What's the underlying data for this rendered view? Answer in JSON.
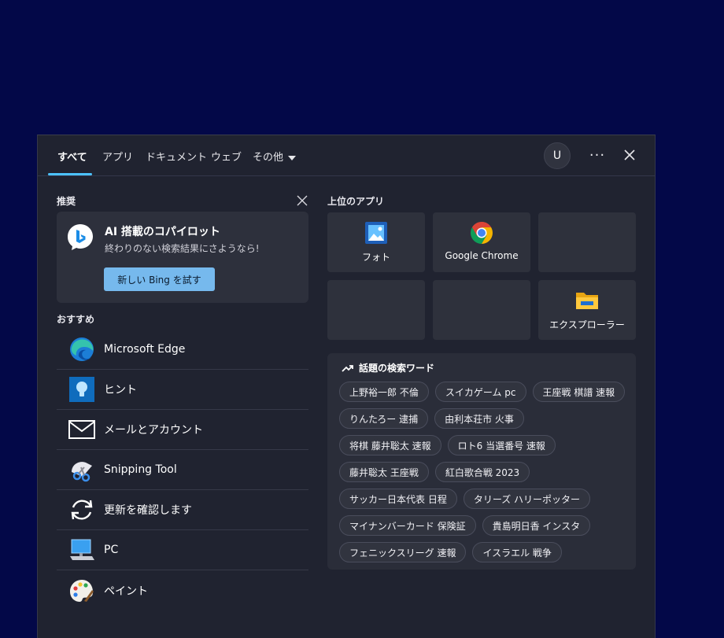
{
  "tabs": [
    {
      "label": "すべて"
    },
    {
      "label": "アプリ"
    },
    {
      "label": "ドキュメント"
    },
    {
      "label": "ウェブ"
    },
    {
      "label": "その他"
    }
  ],
  "account": {
    "initial": "U"
  },
  "toolbar": {
    "more_label": "···"
  },
  "recommended": {
    "label": "推奨",
    "copilot": {
      "title": "AI 搭載のコパイロット",
      "subtitle": "終わりのない検索結果にさようなら!",
      "button_label": "新しい Bing を試す"
    }
  },
  "suggested": {
    "label": "おすすめ",
    "apps": [
      {
        "name": "Microsoft Edge",
        "icon": "edge-icon"
      },
      {
        "name": "ヒント",
        "icon": "tips-icon"
      },
      {
        "name": "メールとアカウント",
        "icon": "mail-icon"
      },
      {
        "name": "Snipping Tool",
        "icon": "snipping-tool-icon"
      },
      {
        "name": "更新を確認します",
        "icon": "update-icon"
      },
      {
        "name": "PC",
        "icon": "pc-icon"
      },
      {
        "name": "ペイント",
        "icon": "paint-icon"
      }
    ]
  },
  "top_apps": {
    "label": "上位のアプリ",
    "tiles": [
      {
        "label": "フォト",
        "icon": "photos-icon"
      },
      {
        "label": "Google Chrome",
        "icon": "chrome-icon"
      },
      {
        "label": "",
        "icon": ""
      },
      {
        "label": "",
        "icon": ""
      },
      {
        "label": "",
        "icon": ""
      },
      {
        "label": "エクスプローラー",
        "icon": "folder-icon"
      }
    ]
  },
  "trending": {
    "label": "話題の検索ワード",
    "rows": [
      [
        "上野裕一郎 不倫",
        "スイカゲーム pc",
        "王座戦 棋譜 速報"
      ],
      [
        "りんたろー 逮捕",
        "由利本荘市 火事"
      ],
      [
        "将棋 藤井聡太 速報",
        "ロト6 当選番号 速報"
      ],
      [
        "藤井聡太 王座戦",
        "紅白歌合戦 2023"
      ],
      [
        "サッカー日本代表 日程",
        "タリーズ ハリーポッター"
      ],
      [
        "マイナンバーカード 保険証",
        "貴島明日香 インスタ"
      ],
      [
        "フェニックスリーグ 速報",
        "イスラエル 戦争"
      ]
    ]
  },
  "colors": {
    "accent": "#4cc2ff",
    "background": "#030848",
    "panel": "#202330",
    "bing_button": "#76b9ed"
  }
}
